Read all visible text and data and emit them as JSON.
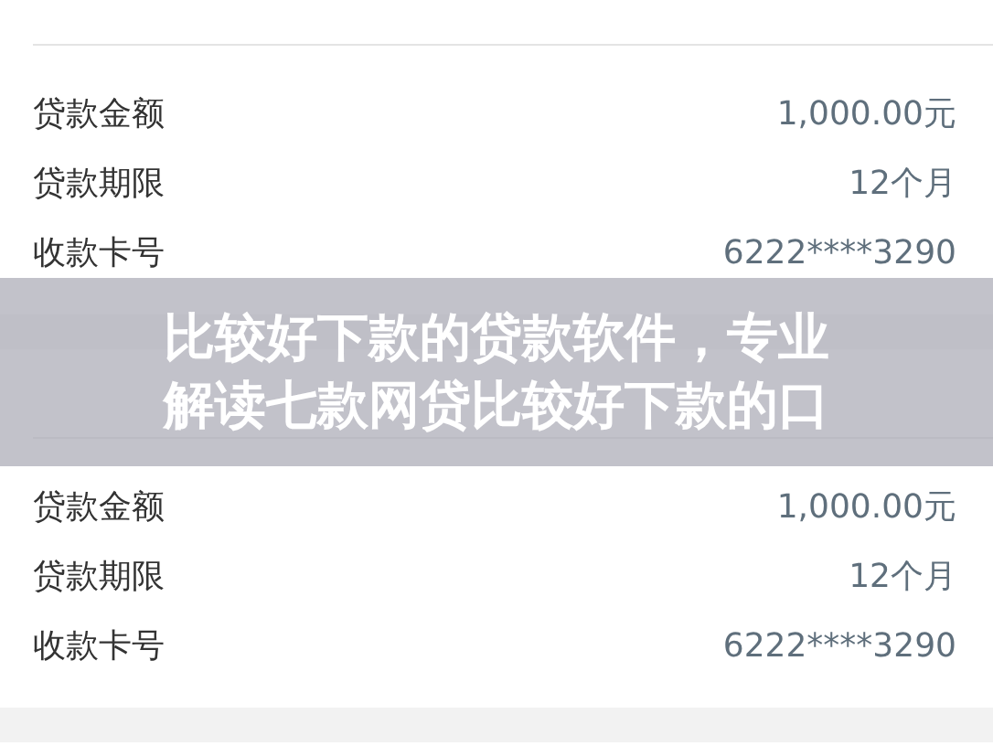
{
  "loans": [
    {
      "details": [
        {
          "label": "贷款金额",
          "value": "1,000.00元"
        },
        {
          "label": "贷款期限",
          "value": "12个月"
        },
        {
          "label": "收款卡号",
          "value": "6222****3290"
        }
      ]
    },
    {
      "details": [
        {
          "label": "贷款金额",
          "value": "1,000.00元"
        },
        {
          "label": "贷款期限",
          "value": "12个月"
        },
        {
          "label": "收款卡号",
          "value": "6222****3290"
        }
      ]
    }
  ],
  "banner": {
    "lines": [
      "比较好下款的贷款软件，专业",
      "解读七款网贷比较好下款的口"
    ]
  }
}
